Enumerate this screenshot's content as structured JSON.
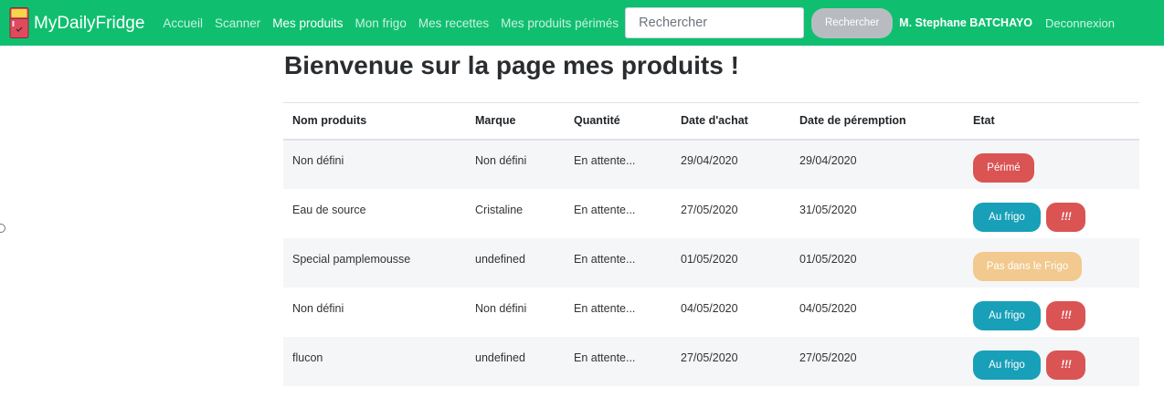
{
  "navbar": {
    "brand": "MyDailyFridge",
    "links": [
      {
        "label": "Accueil",
        "active": false
      },
      {
        "label": "Scanner",
        "active": false
      },
      {
        "label": "Mes produits",
        "active": true
      },
      {
        "label": "Mon frigo",
        "active": false
      },
      {
        "label": "Mes recettes",
        "active": false
      },
      {
        "label": "Mes produits périmés",
        "active": false
      }
    ],
    "search": {
      "placeholder": "Rechercher",
      "value": "",
      "button": "Rechercher"
    },
    "user": "M. Stephane BATCHAYO",
    "logout": "Deconnexion",
    "colors": {
      "bar": "#0fbf6f"
    }
  },
  "page": {
    "title": "Bienvenue sur la page mes produits !"
  },
  "table": {
    "headers": [
      "Nom produits",
      "Marque",
      "Quantité",
      "Date d'achat",
      "Date de péremption",
      "Etat"
    ],
    "rows": [
      {
        "name": "Non défini",
        "brand": "Non défini",
        "quantity": "En attente...",
        "purchase": "29/04/2020",
        "expiry": "29/04/2020",
        "status": [
          {
            "label": "Périmé",
            "color": "#da5454"
          }
        ]
      },
      {
        "name": "Eau de source",
        "brand": "Cristaline",
        "quantity": "En attente...",
        "purchase": "27/05/2020",
        "expiry": "31/05/2020",
        "status": [
          {
            "label": "Au frigo",
            "color": "#18a0b8"
          },
          {
            "label": "!!!",
            "color": "#da5454"
          }
        ]
      },
      {
        "name": "Special pamplemousse",
        "brand": "undefined",
        "quantity": "En attente...",
        "purchase": "01/05/2020",
        "expiry": "01/05/2020",
        "status": [
          {
            "label": "Pas dans le Frigo",
            "color": "#f2c98e"
          }
        ]
      },
      {
        "name": "Non défini",
        "brand": "Non défini",
        "quantity": "En attente...",
        "purchase": "04/05/2020",
        "expiry": "04/05/2020",
        "status": [
          {
            "label": "Au frigo",
            "color": "#18a0b8"
          },
          {
            "label": "!!!",
            "color": "#da5454"
          }
        ]
      },
      {
        "name": "flucon",
        "brand": "undefined",
        "quantity": "En attente...",
        "purchase": "27/05/2020",
        "expiry": "27/05/2020",
        "status": [
          {
            "label": "Au frigo",
            "color": "#18a0b8"
          },
          {
            "label": "!!!",
            "color": "#da5454"
          }
        ]
      }
    ]
  },
  "icons": {
    "logo": "fridge-icon"
  }
}
